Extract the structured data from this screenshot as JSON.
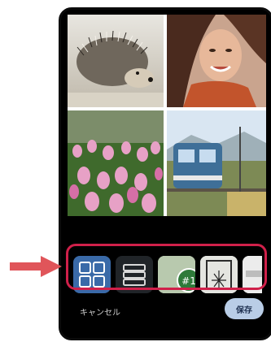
{
  "photos": [
    {
      "name": "hedgehog",
      "alt": "hedgehog"
    },
    {
      "name": "woman",
      "alt": "woman"
    },
    {
      "name": "tulips",
      "alt": "tulips"
    },
    {
      "name": "train",
      "alt": "train"
    }
  ],
  "layout_options": [
    {
      "name": "layout-grid-2x2",
      "icon": "grid-2x2-icon",
      "selected": true
    },
    {
      "name": "layout-stacked-rows",
      "icon": "stacked-rows-icon",
      "selected": false
    },
    {
      "name": "layout-sticker",
      "icon": "sticker-badge-icon",
      "badge_text": "#1",
      "selected": false
    },
    {
      "name": "layout-frame",
      "icon": "frame-icon",
      "selected": false
    },
    {
      "name": "layout-partial",
      "icon": "layout-partial-icon",
      "selected": false
    }
  ],
  "footer": {
    "cancel_label": "キャンセル",
    "save_label": "保存"
  },
  "colors": {
    "highlight": "#d0204a",
    "selected": "#3a6aa8",
    "save_bg": "#b9cde6"
  }
}
